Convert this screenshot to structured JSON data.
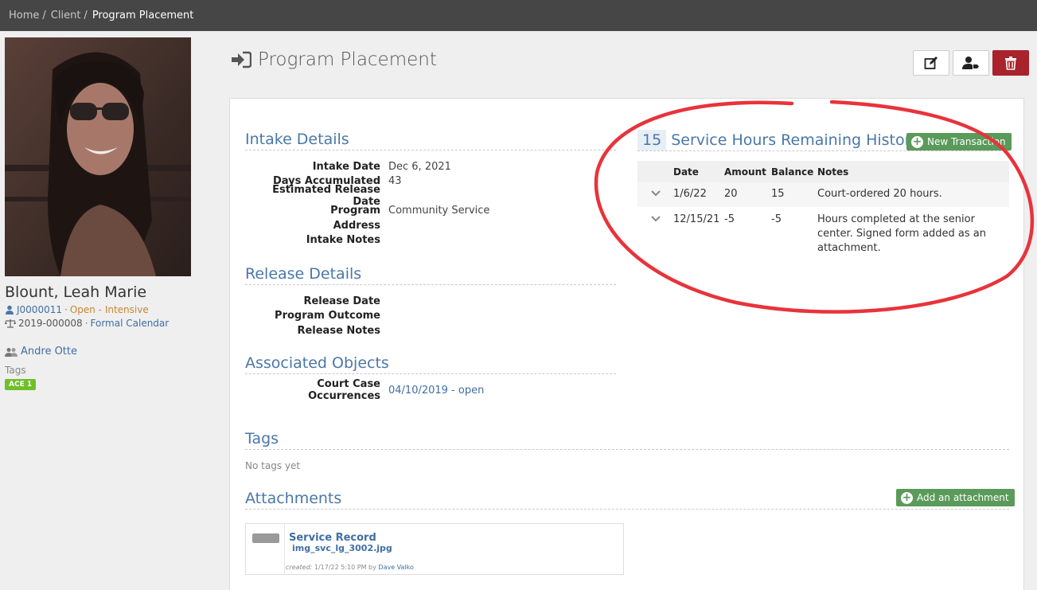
{
  "breadcrumb": {
    "items": [
      "Home",
      "Client"
    ],
    "current": "Program Placement"
  },
  "client": {
    "name": "Blount, Leah Marie",
    "id": "J0000011",
    "status": "Open - Intensive",
    "case_number": "2019-000008",
    "calendar": "Formal Calendar",
    "worker": "Andre Otte",
    "tags_label": "Tags",
    "tag": "ACE 1"
  },
  "page": {
    "title": "Program Placement"
  },
  "intake": {
    "title": "Intake Details",
    "fields": [
      {
        "label": "Intake Date",
        "value": "Dec 6, 2021"
      },
      {
        "label": "Days Accumulated",
        "value": "43"
      },
      {
        "label": "Estimated Release Date",
        "value": ""
      },
      {
        "label": "Program",
        "value": "Community Service"
      },
      {
        "label": "Address",
        "value": ""
      },
      {
        "label": "Intake Notes",
        "value": ""
      }
    ]
  },
  "release": {
    "title": "Release Details",
    "fields": [
      {
        "label": "Release Date",
        "value": ""
      },
      {
        "label": "Program Outcome",
        "value": ""
      },
      {
        "label": "Release Notes",
        "value": ""
      }
    ]
  },
  "associated": {
    "title": "Associated Objects",
    "fields": [
      {
        "label": "Court Case Occurrences",
        "value": "04/10/2019 - open"
      }
    ]
  },
  "hours": {
    "count": "15",
    "title": "Service Hours Remaining History",
    "new_button": "New Transaction",
    "columns": [
      "Date",
      "Amount",
      "Balance",
      "Notes"
    ],
    "rows": [
      {
        "date": "1/6/22",
        "amount": "20",
        "balance": "15",
        "notes": "Court-ordered 20 hours."
      },
      {
        "date": "12/15/21",
        "amount": "-5",
        "balance": "-5",
        "notes": "Hours completed at the senior center. Signed form added as an attachment."
      }
    ]
  },
  "tags_section": {
    "title": "Tags",
    "empty": "No tags yet"
  },
  "attachments": {
    "title": "Attachments",
    "add_button": "Add an attachment",
    "item": {
      "title": "Service Record",
      "file": "img_svc_lg_3002.jpg",
      "created_label": "created:",
      "created": "1/17/22 5:10 PM by",
      "author": "Dave Valko"
    }
  },
  "colors": {
    "topbar": "#464646",
    "link": "#3f6ea3",
    "danger": "#a8232c",
    "green_button": "#5a9a5a",
    "annotation": "#e8333b"
  }
}
